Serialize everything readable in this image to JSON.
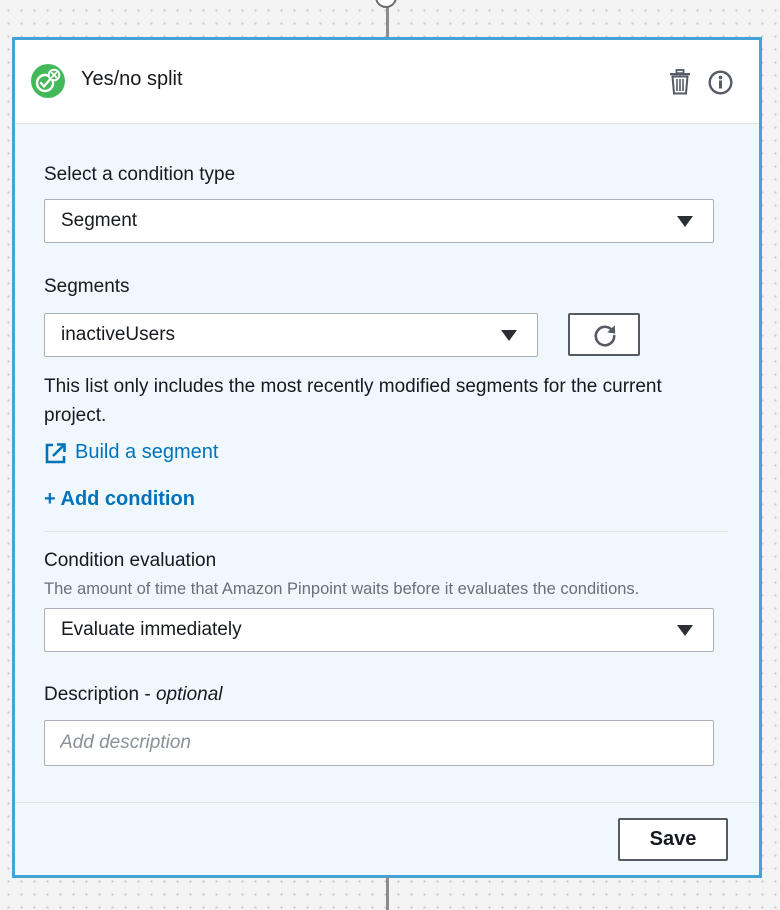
{
  "node": {
    "title": "Yes/no split",
    "icon": "yes-no-split-icon",
    "accent_color": "#43b95a",
    "border_color": "#44a4d6"
  },
  "header_actions": [
    {
      "icon": "trash-icon"
    },
    {
      "icon": "info-icon"
    }
  ],
  "condition_type": {
    "label": "Select a condition type",
    "selected": "Segment"
  },
  "segments": {
    "label": "Segments",
    "selected": "inactiveUsers",
    "refresh_icon": "refresh-icon",
    "help_text": "This list only includes the most recently modified segments for the current project.",
    "build_link": "Build a segment",
    "build_link_icon": "external-link-icon"
  },
  "add_condition": {
    "label": "+ Add condition"
  },
  "condition_evaluation": {
    "label": "Condition evaluation",
    "description": "The amount of time that Amazon Pinpoint waits before it evaluates the conditions.",
    "selected": "Evaluate immediately"
  },
  "description_field": {
    "label": "Description",
    "label_suffix": " - ",
    "optional": "optional",
    "placeholder": "Add description",
    "value": ""
  },
  "footer": {
    "save_label": "Save"
  }
}
